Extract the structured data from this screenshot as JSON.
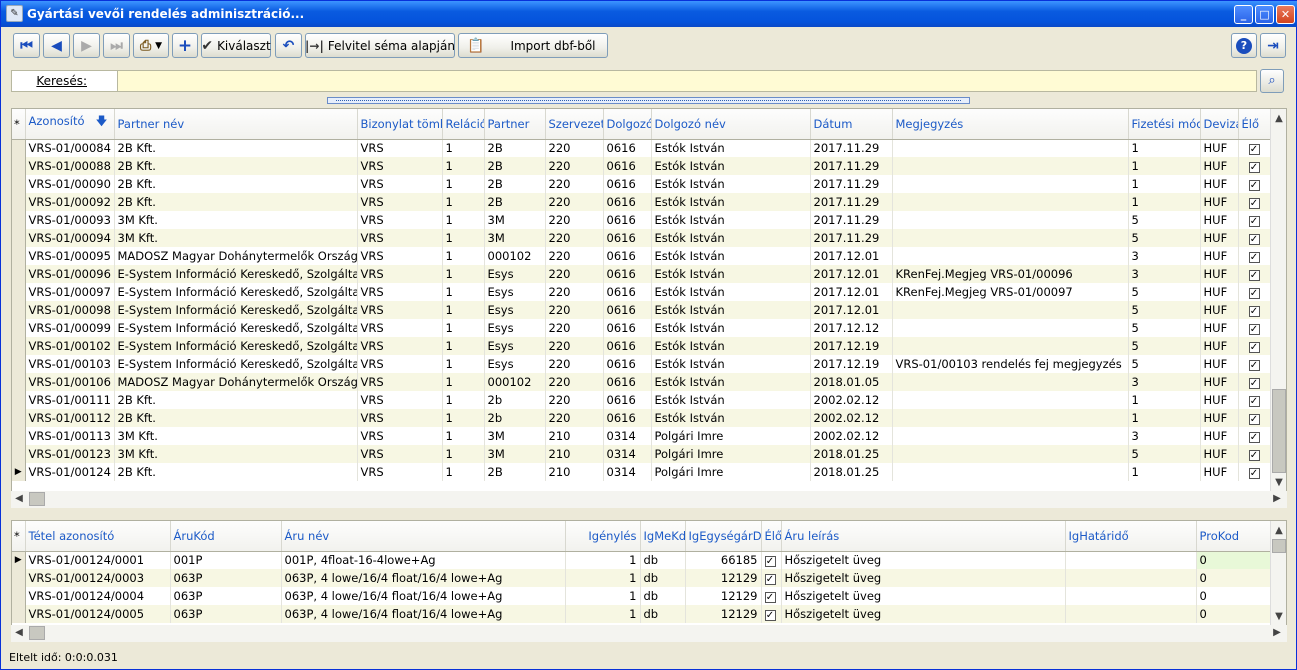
{
  "window": {
    "title": "Gyártási vevői rendelés adminisztráció..."
  },
  "toolbar": {
    "select_label": "Kiválaszt",
    "schema_label": "Felvitel séma alapján",
    "import_label": "Import dbf-ből"
  },
  "search": {
    "label": "Keresés:",
    "value": ""
  },
  "main_table": {
    "columns": [
      "*",
      "Azonosító",
      "Partner név",
      "Bizonylat tömb",
      "Reláció",
      "Partner",
      "Szervezet",
      "Dolgozó",
      "Dolgozó név",
      "Dátum",
      "Megjegyzés",
      "Fizetési mód",
      "Deviza",
      "Élő"
    ],
    "rows": [
      [
        "VRS-01/00084",
        "2B Kft.",
        "VRS",
        "1",
        "2B",
        "220",
        "0616",
        "Estók István",
        "2017.11.29",
        "",
        "1",
        "HUF"
      ],
      [
        "VRS-01/00088",
        "2B Kft.",
        "VRS",
        "1",
        "2B",
        "220",
        "0616",
        "Estók István",
        "2017.11.29",
        "",
        "1",
        "HUF"
      ],
      [
        "VRS-01/00090",
        "2B Kft.",
        "VRS",
        "1",
        "2B",
        "220",
        "0616",
        "Estók István",
        "2017.11.29",
        "",
        "1",
        "HUF"
      ],
      [
        "VRS-01/00092",
        "2B Kft.",
        "VRS",
        "1",
        "2B",
        "220",
        "0616",
        "Estók István",
        "2017.11.29",
        "",
        "1",
        "HUF"
      ],
      [
        "VRS-01/00093",
        "3M Kft.",
        "VRS",
        "1",
        "3M",
        "220",
        "0616",
        "Estók István",
        "2017.11.29",
        "",
        "5",
        "HUF"
      ],
      [
        "VRS-01/00094",
        "3M Kft.",
        "VRS",
        "1",
        "3M",
        "220",
        "0616",
        "Estók István",
        "2017.11.29",
        "",
        "5",
        "HUF"
      ],
      [
        "VRS-01/00095",
        "MADOSZ Magyar Dohánytermelők Országos",
        "VRS",
        "1",
        "000102",
        "220",
        "0616",
        "Estók István",
        "2017.12.01",
        "",
        "3",
        "HUF"
      ],
      [
        "VRS-01/00096",
        "E-System Információ Kereskedő, Szolgáltató",
        "VRS",
        "1",
        "Esys",
        "220",
        "0616",
        "Estók István",
        "2017.12.01",
        "KRenFej.Megjeg VRS-01/00096",
        "3",
        "HUF"
      ],
      [
        "VRS-01/00097",
        "E-System Információ Kereskedő, Szolgáltató",
        "VRS",
        "1",
        "Esys",
        "220",
        "0616",
        "Estók István",
        "2017.12.01",
        "KRenFej.Megjeg VRS-01/00097",
        "5",
        "HUF"
      ],
      [
        "VRS-01/00098",
        "E-System Információ Kereskedő, Szolgáltató",
        "VRS",
        "1",
        "Esys",
        "220",
        "0616",
        "Estók István",
        "2017.12.01",
        "",
        "5",
        "HUF"
      ],
      [
        "VRS-01/00099",
        "E-System Információ Kereskedő, Szolgáltató",
        "VRS",
        "1",
        "Esys",
        "220",
        "0616",
        "Estók István",
        "2017.12.12",
        "",
        "5",
        "HUF"
      ],
      [
        "VRS-01/00102",
        "E-System Információ Kereskedő, Szolgáltató",
        "VRS",
        "1",
        "Esys",
        "220",
        "0616",
        "Estók István",
        "2017.12.19",
        "",
        "5",
        "HUF"
      ],
      [
        "VRS-01/00103",
        "E-System Információ Kereskedő, Szolgáltató",
        "VRS",
        "1",
        "Esys",
        "220",
        "0616",
        "Estók István",
        "2017.12.19",
        "VRS-01/00103 rendelés fej megjegyzés",
        "5",
        "HUF"
      ],
      [
        "VRS-01/00106",
        "MADOSZ Magyar Dohánytermelők Országos",
        "VRS",
        "1",
        "000102",
        "220",
        "0616",
        "Estók István",
        "2018.01.05",
        "",
        "3",
        "HUF"
      ],
      [
        "VRS-01/00111",
        "2B Kft.",
        "VRS",
        "1",
        "2b",
        "220",
        "0616",
        "Estók István",
        "2002.02.12",
        "",
        "1",
        "HUF"
      ],
      [
        "VRS-01/00112",
        "2B Kft.",
        "VRS",
        "1",
        "2b",
        "220",
        "0616",
        "Estók István",
        "2002.02.12",
        "",
        "1",
        "HUF"
      ],
      [
        "VRS-01/00113",
        "3M Kft.",
        "VRS",
        "1",
        "3M",
        "210",
        "0314",
        "Polgári Imre",
        "2002.02.12",
        "",
        "3",
        "HUF"
      ],
      [
        "VRS-01/00123",
        "3M Kft.",
        "VRS",
        "1",
        "3M",
        "210",
        "0314",
        "Polgári Imre",
        "2018.01.25",
        "",
        "5",
        "HUF"
      ],
      [
        "VRS-01/00124",
        "2B Kft.",
        "VRS",
        "1",
        "2B",
        "210",
        "0314",
        "Polgári Imre",
        "2018.01.25",
        "",
        "1",
        "HUF"
      ]
    ]
  },
  "detail_table": {
    "columns": [
      "*",
      "Tétel azonosító",
      "ÁruKód",
      "Áru név",
      "Igénylés",
      "IgMeKd",
      "IgEgységárD",
      "Élő",
      "Áru leírás",
      "IgHatáridő",
      "ProKod"
    ],
    "rows": [
      [
        "VRS-01/00124/0001",
        "001P",
        "001P, 4float-16-4lowe+Ag",
        "1",
        "db",
        "66185",
        "Hőszigetelt üveg",
        "",
        "0"
      ],
      [
        "VRS-01/00124/0003",
        "063P",
        "063P, 4 lowe/16/4 float/16/4 lowe+Ag",
        "1",
        "db",
        "12129",
        "Hőszigetelt üveg",
        "",
        "0"
      ],
      [
        "VRS-01/00124/0004",
        "063P",
        "063P, 4 lowe/16/4 float/16/4 lowe+Ag",
        "1",
        "db",
        "12129",
        "Hőszigetelt üveg",
        "",
        "0"
      ],
      [
        "VRS-01/00124/0005",
        "063P",
        "063P, 4 lowe/16/4 float/16/4 lowe+Ag",
        "1",
        "db",
        "12129",
        "Hőszigetelt üveg",
        "",
        "0"
      ]
    ]
  },
  "status": {
    "elapsed": "Eltelt idő: 0:0:0.031"
  }
}
